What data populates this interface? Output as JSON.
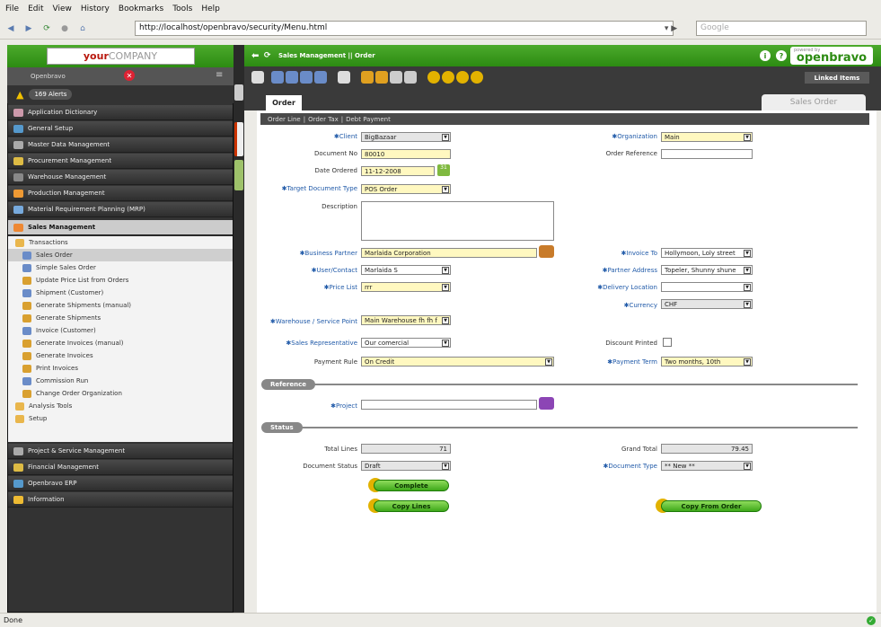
{
  "menubar": {
    "file": "File",
    "edit": "Edit",
    "view": "View",
    "history": "History",
    "bookmarks": "Bookmarks",
    "tools": "Tools",
    "help": "Help"
  },
  "browser": {
    "url": "http://localhost/openbravo/security/Menu.html",
    "search_placeholder": "Google"
  },
  "left": {
    "logo_your": "your",
    "logo_company": "COMPANY",
    "user": "Openbravo",
    "alerts": "169 Alerts",
    "menu": [
      "Application Dictionary",
      "General Setup",
      "Master Data Management",
      "Procurement Management",
      "Warehouse Management",
      "Production Management",
      "Material Requirement Planning (MRP)",
      "Sales Management"
    ],
    "sub": [
      "Transactions",
      "Sales Order",
      "Simple Sales Order",
      "Update Price List from Orders",
      "Shipment (Customer)",
      "Generate Shipments (manual)",
      "Generate Shipments",
      "Invoice (Customer)",
      "Generate Invoices (manual)",
      "Generate Invoices",
      "Print Invoices",
      "Commission Run",
      "Change Order Organization",
      "Analysis Tools",
      "Setup"
    ],
    "menu2": [
      "Project & Service Management",
      "Financial Management",
      "Openbravo ERP",
      "Information"
    ]
  },
  "header": {
    "breadcrumb": "Sales Management  ||  Order",
    "brand": "openbravo",
    "powered": "powered by",
    "linked": "Linked Items"
  },
  "tabs": {
    "order": "Order",
    "window": "Sales Order",
    "sub": [
      "Order Line",
      "Order Tax",
      "Debt Payment"
    ]
  },
  "form": {
    "client_label": "Client",
    "client": "BigBazaar",
    "org_label": "Organization",
    "org": "Main",
    "docno_label": "Document No",
    "docno": "80010",
    "orderref_label": "Order Reference",
    "orderref": "",
    "date_label": "Date Ordered",
    "date": "11-12-2008",
    "targetdoc_label": "Target Document Type",
    "targetdoc": "POS Order",
    "desc_label": "Description",
    "desc": "",
    "bp_label": "Business Partner",
    "bp": "Marlaida Corporation",
    "invto_label": "Invoice To",
    "invto": "Hollymoon, Loly street",
    "contact_label": "User/Contact",
    "contact": "Marlaida S",
    "paddr_label": "Partner Address",
    "paddr": "Topeler, Shunny shune",
    "price_label": "Price List",
    "price": "rrr",
    "delivloc_label": "Delivery Location",
    "delivloc": "",
    "currency_label": "Currency",
    "currency": "CHF",
    "wh_label": "Warehouse / Service Point",
    "wh": "Main Warehouse fh fh f",
    "rep_label": "Sales Representative",
    "rep": "Our comercial",
    "discount_label": "Discount Printed",
    "payrule_label": "Payment Rule",
    "payrule": "On Credit",
    "payterm_label": "Payment Term",
    "payterm": "Two months, 10th",
    "reference": "Reference",
    "project_label": "Project",
    "project": "",
    "status": "Status",
    "lines_label": "Total Lines",
    "lines": "71",
    "grand_label": "Grand Total",
    "grand": "79.45",
    "docstatus_label": "Document Status",
    "docstatus": "Draft",
    "doctype_label": "Document Type",
    "doctype": "** New **",
    "complete": "Complete",
    "copylines": "Copy Lines",
    "copyfrom": "Copy From Order"
  },
  "statusbar": "Done"
}
